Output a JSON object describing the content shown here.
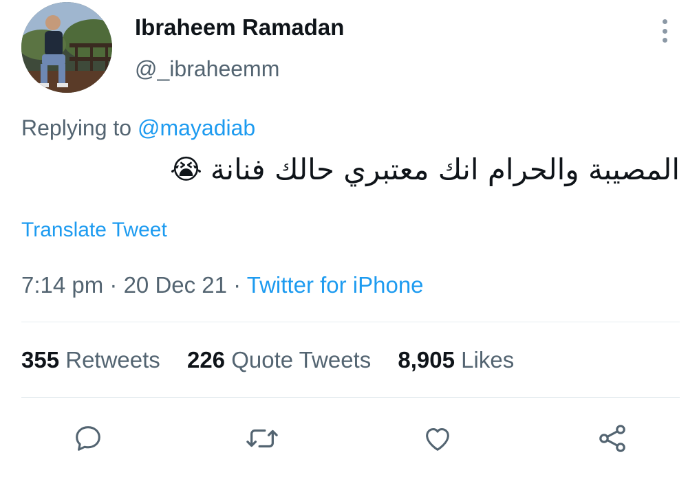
{
  "user": {
    "display_name": "Ibraheem Ramadan",
    "handle": "@_ibraheemm"
  },
  "reply": {
    "prefix": "Replying to ",
    "mention": "@mayadiab"
  },
  "tweet": {
    "text": "المصيبة والحرام انك معتبري حالك فنانة",
    "emoji": "😭",
    "translate_label": "Translate Tweet"
  },
  "meta": {
    "time": "7:14 pm",
    "separator": " · ",
    "date": "20 Dec 21",
    "source": "Twitter for iPhone"
  },
  "stats": {
    "retweets": {
      "count": "355",
      "label": "Retweets"
    },
    "quotes": {
      "count": "226",
      "label": "Quote Tweets"
    },
    "likes": {
      "count": "8,905",
      "label": "Likes"
    }
  },
  "icons": {
    "more": "more-vertical-icon",
    "reply": "reply-icon",
    "retweet": "retweet-icon",
    "like": "heart-icon",
    "share": "share-icon"
  },
  "colors": {
    "link": "#1d9bf0",
    "secondary_text": "#536471",
    "primary_text": "#0f1419",
    "icon": "#536471"
  }
}
